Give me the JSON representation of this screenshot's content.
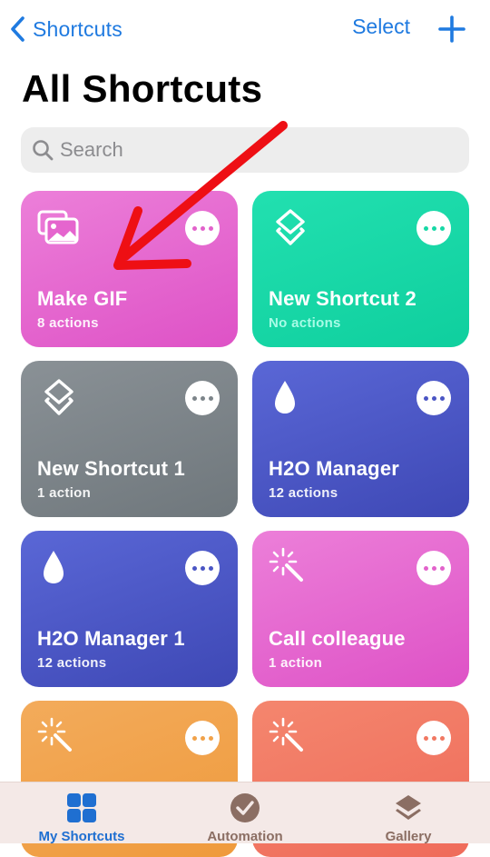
{
  "nav": {
    "back_label": "Shortcuts",
    "select_label": "Select",
    "back_icon": "chevron-left-icon",
    "add_icon": "plus-icon"
  },
  "page": {
    "title": "All Shortcuts"
  },
  "search": {
    "placeholder": "Search",
    "icon": "search-icon"
  },
  "colors": {
    "accent": "#1f7ae0",
    "pink": "#e262cb",
    "teal": "#16d8a6",
    "gray": "#7d858a",
    "indigo": "#4a55c4",
    "orange": "#f1a24a",
    "coral": "#f17862",
    "annotation_arrow": "#ee0f14"
  },
  "shortcuts": [
    {
      "name": "Make GIF",
      "subtitle": "8 actions",
      "color": "pink",
      "icon": "photos-icon"
    },
    {
      "name": "New Shortcut 2",
      "subtitle": "No actions",
      "color": "teal",
      "icon": "layers-icon"
    },
    {
      "name": "New Shortcut 1",
      "subtitle": "1 action",
      "color": "gray",
      "icon": "layers-icon"
    },
    {
      "name": "H2O Manager",
      "subtitle": "12 actions",
      "color": "indigo",
      "icon": "drop-icon"
    },
    {
      "name": "H2O Manager 1",
      "subtitle": "12 actions",
      "color": "indigo",
      "icon": "drop-icon"
    },
    {
      "name": "Call colleague",
      "subtitle": "1 action",
      "color": "pink",
      "icon": "magic-wand-icon"
    },
    {
      "name": "",
      "subtitle": "",
      "color": "orange",
      "icon": "magic-wand-icon"
    },
    {
      "name": "",
      "subtitle": "",
      "color": "coral",
      "icon": "magic-wand-icon"
    }
  ],
  "tabbar": {
    "tabs": [
      {
        "label": "My Shortcuts",
        "icon": "grid-icon",
        "active": true
      },
      {
        "label": "Automation",
        "icon": "clock-check-icon",
        "active": false
      },
      {
        "label": "Gallery",
        "icon": "layers-icon",
        "active": false
      }
    ]
  }
}
